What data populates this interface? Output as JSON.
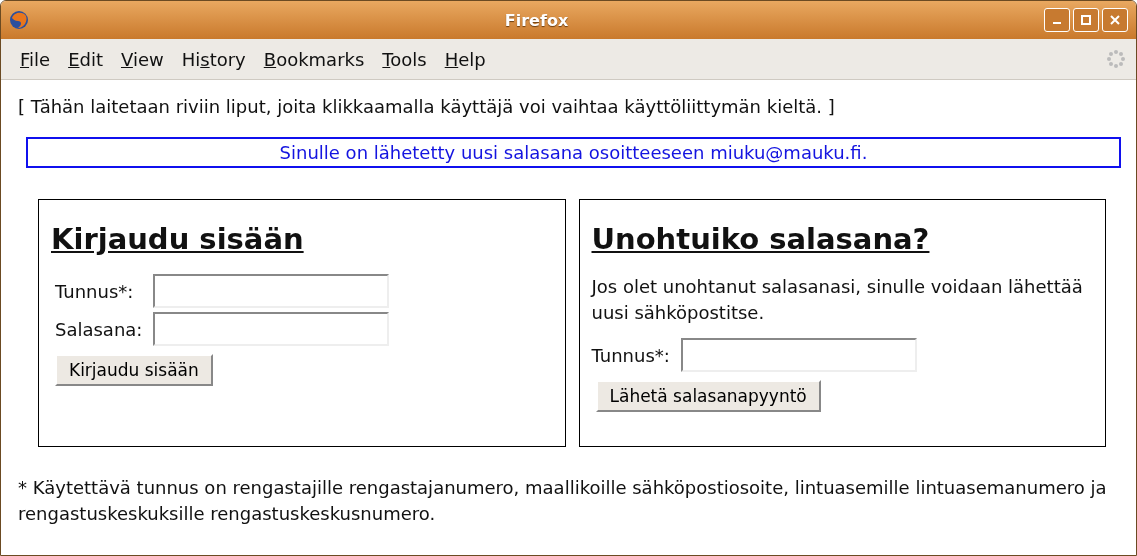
{
  "window": {
    "title": "Firefox"
  },
  "menu": [
    {
      "key": "F",
      "post": "ile"
    },
    {
      "key": "E",
      "post": "dit"
    },
    {
      "key": "V",
      "post": "iew"
    },
    {
      "pre": "Hi",
      "key": "s",
      "post": "tory"
    },
    {
      "key": "B",
      "post": "ookmarks"
    },
    {
      "key": "T",
      "post": "ools"
    },
    {
      "key": "H",
      "post": "elp"
    }
  ],
  "page": {
    "flags_note": "[ Tähän laitetaan riviin liput, joita klikkaamalla käyttäjä voi vaihtaa käyttöliittymän kieltä. ]",
    "notice": "Sinulle on lähetetty uusi salasana osoitteeseen miuku@mauku.fi.",
    "login": {
      "heading": "Kirjaudu sisään",
      "fields": [
        {
          "label": "Tunnus*:"
        },
        {
          "label": "Salasana:"
        }
      ],
      "button": "Kirjaudu sisään"
    },
    "forgot": {
      "heading": "Unohtuiko salasana?",
      "text": "Jos olet unohtanut salasanasi, sinulle voidaan lähettää uusi sähköpostitse.",
      "fields": [
        {
          "label": "Tunnus*:"
        }
      ],
      "button": "Lähetä salasanapyyntö"
    },
    "footnote": "* Käytettävä tunnus on rengastajille rengastajanumero, maallikoille sähköpostiosoite, lintuasemille lintuasemanumero ja rengastuskeskuksille rengastuskeskusnumero."
  }
}
